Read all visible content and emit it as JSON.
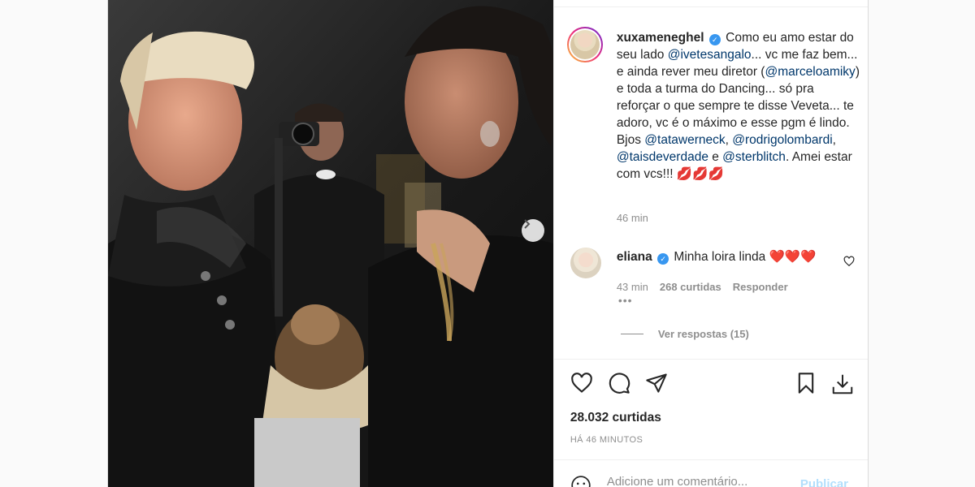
{
  "post": {
    "author": "xuxameneghel",
    "caption_segments": [
      {
        "type": "text",
        "value": "Como eu amo estar do seu lado "
      },
      {
        "type": "mention",
        "value": "@ivetesangalo"
      },
      {
        "type": "text",
        "value": "... vc me faz bem... e ainda rever meu diretor ("
      },
      {
        "type": "mention",
        "value": "@marceloamiky"
      },
      {
        "type": "text",
        "value": ") e toda a turma do Dancing... só pra reforçar o que sempre te disse Veveta... te adoro, vc é o máximo e esse pgm é lindo. Bjos "
      },
      {
        "type": "mention",
        "value": "@tatawerneck"
      },
      {
        "type": "text",
        "value": ", "
      },
      {
        "type": "mention",
        "value": "@rodrigolombardi"
      },
      {
        "type": "text",
        "value": ", "
      },
      {
        "type": "mention",
        "value": "@taisdeverdade"
      },
      {
        "type": "text",
        "value": " e "
      },
      {
        "type": "mention",
        "value": "@sterblitch"
      },
      {
        "type": "text",
        "value": ". Amei estar com vcs!!! 💋💋💋"
      }
    ],
    "caption_time": "46 min",
    "likes": "28.032 curtidas",
    "posted_ago": "HÁ 46 MINUTOS"
  },
  "comment": {
    "author": "eliana",
    "text": "Minha loira linda ❤️❤️❤️",
    "time": "43 min",
    "likes": "268 curtidas",
    "reply_label": "Responder",
    "more": "•••",
    "view_replies": "Ver respostas (15)"
  },
  "composer": {
    "placeholder": "Adicione um comentário...",
    "publish_label": "Publicar"
  },
  "icons": {
    "like": "heart-icon",
    "comment": "comment-bubble-icon",
    "share": "paper-plane-icon",
    "save": "bookmark-icon",
    "download": "download-icon",
    "emoji": "smiley-icon",
    "next": "chevron-right-icon",
    "verified": "verified-badge-icon"
  },
  "colors": {
    "mention": "#00376b",
    "verified": "#3897f0",
    "publish_disabled": "#b2dffc",
    "muted": "#8e8e8e"
  }
}
